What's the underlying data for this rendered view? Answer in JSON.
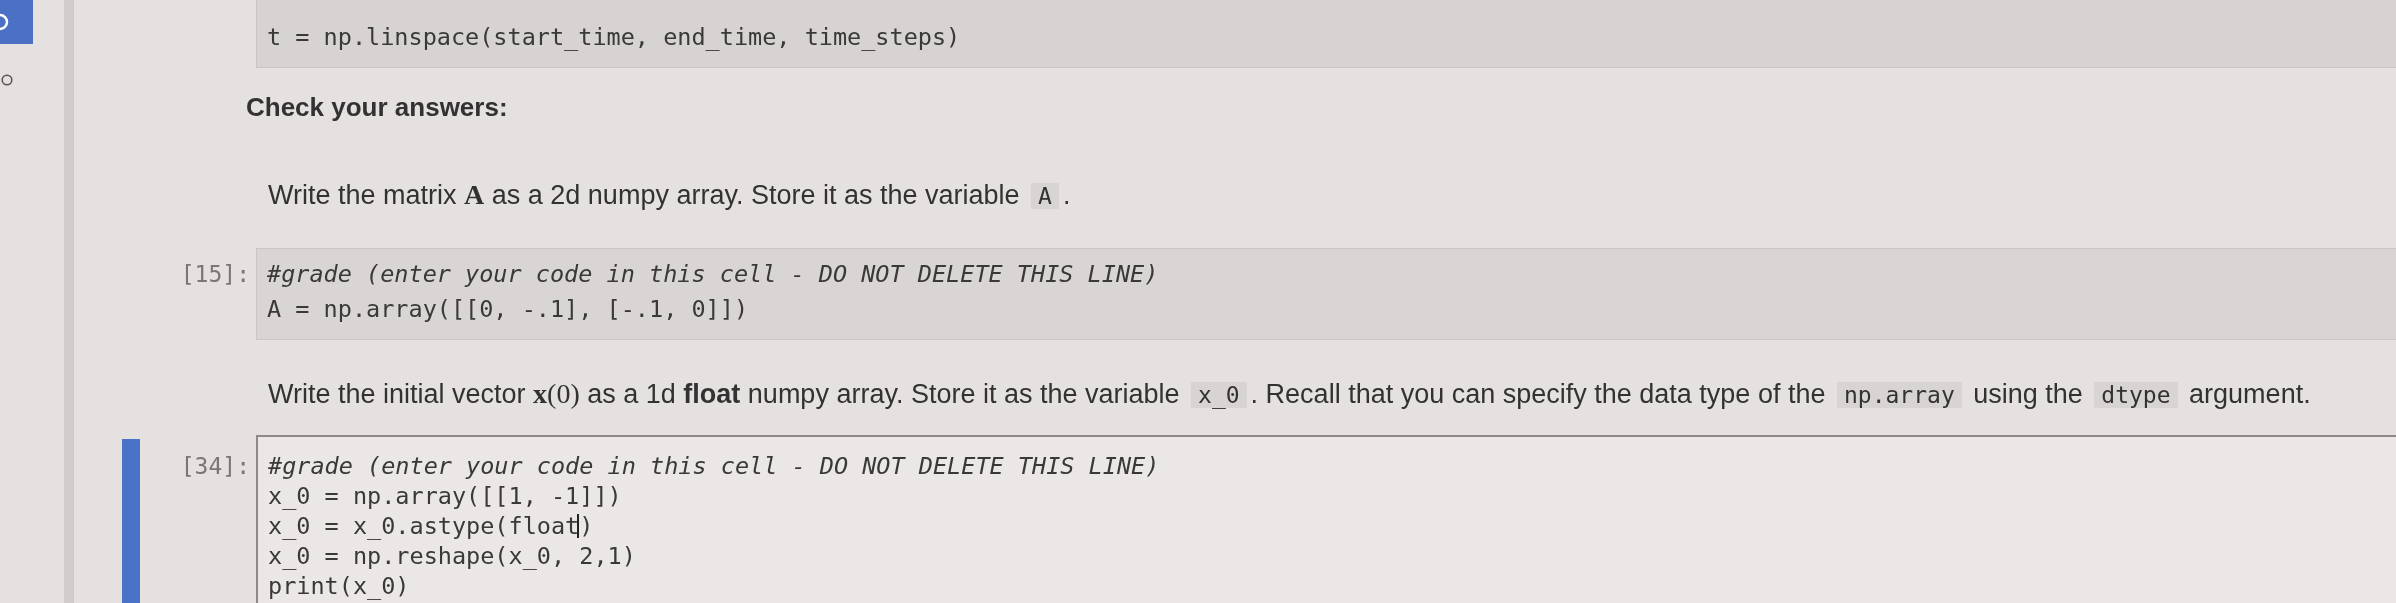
{
  "cells": [
    {
      "kind": "code",
      "selected": false,
      "lines": [
        {
          "kind": "code",
          "text": "t = np.linspace(start_time, end_time, time_steps)",
          "cursor": false
        }
      ]
    },
    {
      "kind": "heading",
      "text": "Check your answers:"
    },
    {
      "kind": "paragraph",
      "segments": [
        {
          "kind": "text",
          "text": "Write the matrix "
        },
        {
          "kind": "math-bold",
          "text": "A"
        },
        {
          "kind": "text",
          "text": " as a 2d numpy array. Store it as the variable "
        },
        {
          "kind": "code",
          "text": "A"
        },
        {
          "kind": "text",
          "text": "."
        }
      ]
    },
    {
      "kind": "code",
      "prompt": "[15]:",
      "selected": false,
      "lines": [
        {
          "kind": "comment",
          "text": "#grade (enter your code in this cell - DO NOT DELETE THIS LINE)",
          "cursor": false
        },
        {
          "kind": "code",
          "text": "A = np.array([[0, -.1], [-.1, 0]])",
          "cursor": false
        }
      ]
    },
    {
      "kind": "paragraph",
      "segments": [
        {
          "kind": "text",
          "text": "Write the initial vector "
        },
        {
          "kind": "math-bold",
          "text": "x"
        },
        {
          "kind": "math",
          "text": "(0)"
        },
        {
          "kind": "text",
          "text": " as a 1d "
        },
        {
          "kind": "bold",
          "text": "float"
        },
        {
          "kind": "text",
          "text": " numpy array. Store it as the variable "
        },
        {
          "kind": "code",
          "text": "x_0"
        },
        {
          "kind": "text",
          "text": ". Recall that you can specify the data type of the "
        },
        {
          "kind": "code",
          "text": "np.array"
        },
        {
          "kind": "text",
          "text": " using the "
        },
        {
          "kind": "code",
          "text": "dtype"
        },
        {
          "kind": "text",
          "text": " argument."
        }
      ]
    },
    {
      "kind": "code",
      "prompt": "[34]:",
      "selected": true,
      "lines": [
        {
          "kind": "comment",
          "text": "#grade (enter your code in this cell - DO NOT DELETE THIS LINE)",
          "cursor": false
        },
        {
          "kind": "code",
          "text": "x_0 = np.array([[1, -1]])",
          "cursor": false
        },
        {
          "kind": "code",
          "text": "x_0 = x_0.astype(float)",
          "cursor": true
        },
        {
          "kind": "code",
          "text": "x_0 = np.reshape(x_0, 2,1)",
          "cursor": false
        },
        {
          "kind": "code",
          "text": "print(x_0)",
          "cursor": false
        }
      ]
    }
  ]
}
